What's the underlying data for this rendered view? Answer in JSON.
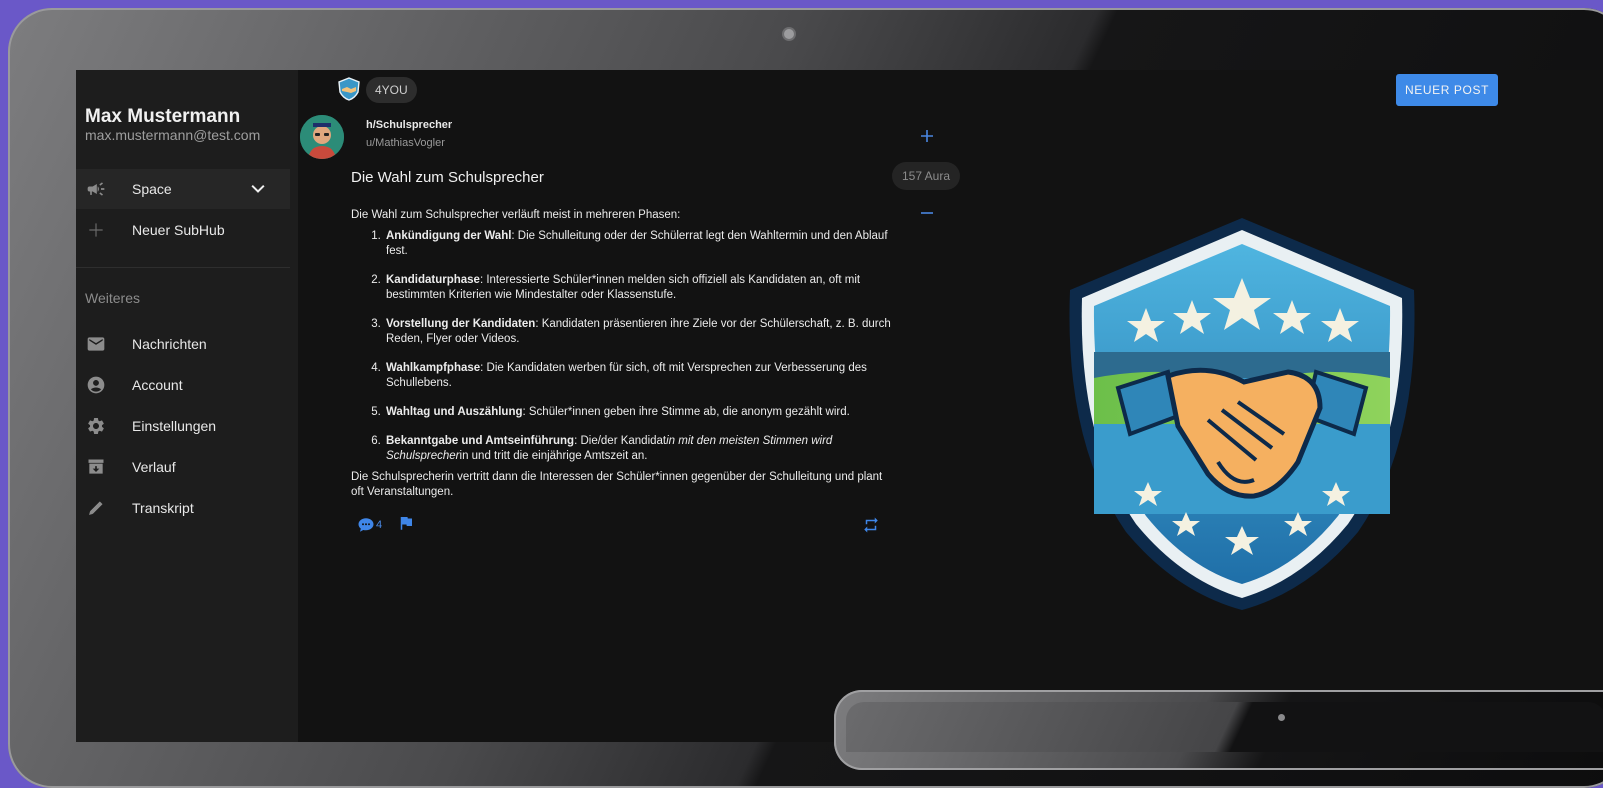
{
  "sidebar": {
    "user_name": "Max Mustermann",
    "user_email": "max.mustermann@test.com",
    "items": [
      {
        "label": "Space",
        "icon": "megaphone-icon"
      },
      {
        "label": "Neuer SubHub",
        "icon": "plus-icon"
      }
    ],
    "section_label": "Weiteres",
    "more_items": [
      {
        "label": "Nachrichten",
        "icon": "mail-icon"
      },
      {
        "label": "Account",
        "icon": "account-circle-icon"
      },
      {
        "label": "Einstellungen",
        "icon": "gear-icon"
      },
      {
        "label": "Verlauf",
        "icon": "archive-icon"
      },
      {
        "label": "Transkript",
        "icon": "pencil-icon"
      }
    ]
  },
  "header": {
    "chip_label": "4YOU",
    "new_post_label": "NEUER POST"
  },
  "post": {
    "subhub": "h/Schulsprecher",
    "author": "u/MathiasVogler",
    "aura": "157 Aura",
    "title": "Die Wahl zum Schulsprecher",
    "intro": "Die Wahl zum Schulsprecher verläuft meist in mehreren Phasen:",
    "steps": [
      {
        "bold": "Ankündigung der Wahl",
        "text": ": Die Schulleitung oder der Schülerrat legt den Wahltermin und den Ablauf fest."
      },
      {
        "bold": "Kandidaturphase",
        "text": ": Interessierte Schüler*innen melden sich offiziell als Kandidaten an, oft mit bestimmten Kriterien wie Mindestalter oder Klassenstufe."
      },
      {
        "bold": "Vorstellung der Kandidaten",
        "text": ": Kandidaten präsentieren ihre Ziele vor der Schülerschaft, z. B. durch Reden, Flyer oder Videos."
      },
      {
        "bold": "Wahlkampfphase",
        "text": ": Die Kandidaten werben für sich, oft mit Versprechen zur Verbesserung des Schullebens."
      },
      {
        "bold": "Wahltag und Auszählung",
        "text": ": Schüler*innen geben ihre Stimme ab, die anonym gezählt wird."
      },
      {
        "bold": "Bekanntgabe und Amtseinführung",
        "text": ": Die/der Kandidat",
        "italic": "in mit den meisten Stimmen wird Schulsprecher",
        "tail": "in und tritt die einjährige Amtszeit an."
      }
    ],
    "outro": "Die Schulsprecherin vertritt dann die Interessen der Schüler*innen gegenüber der Schulleitung und plant oft Veranstaltungen.",
    "comment_count": "4"
  },
  "colors": {
    "accent": "#3e8ae8",
    "background": "#121212",
    "sidebar": "#1d1d1d"
  }
}
